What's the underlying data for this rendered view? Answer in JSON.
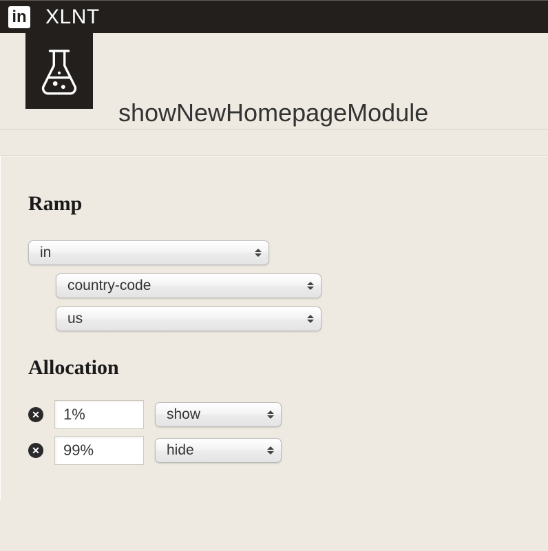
{
  "header": {
    "app_name": "XLNT",
    "logo_text": "in"
  },
  "page": {
    "title": "showNewHomepageModule",
    "icon_name": "flask-icon"
  },
  "ramp": {
    "heading": "Ramp",
    "operator": "in",
    "field": "country-code",
    "value": "us"
  },
  "allocation": {
    "heading": "Allocation",
    "rows": [
      {
        "percent": "1%",
        "treatment": "show"
      },
      {
        "percent": "99%",
        "treatment": "hide"
      }
    ]
  }
}
